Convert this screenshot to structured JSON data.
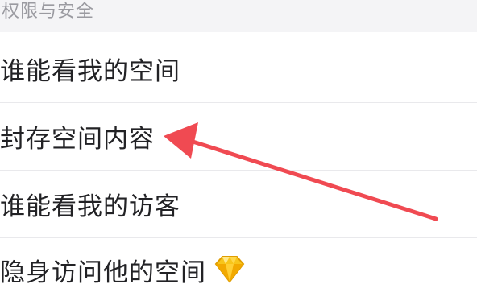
{
  "section": {
    "title": "权限与安全"
  },
  "rows": [
    {
      "label": "谁能看我的空间"
    },
    {
      "label": "封存空间内容"
    },
    {
      "label": "谁能看我的访客"
    },
    {
      "label": "隐身访问他的空间",
      "icon": "diamond-icon"
    }
  ],
  "annotation": {
    "icon": "red-arrow-icon",
    "color": "#f04a52"
  },
  "colors": {
    "section_bg": "#f4f4f6",
    "section_text": "#9a9aa0",
    "row_text": "#222225",
    "divider": "#e9e9ec",
    "diamond": "#f5b51e"
  }
}
